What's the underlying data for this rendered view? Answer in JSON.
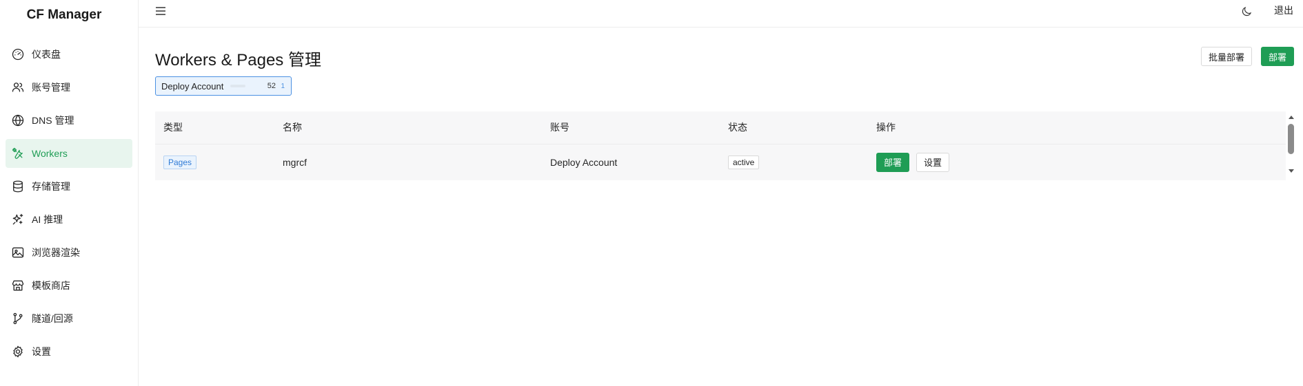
{
  "app": {
    "title": "CF Manager"
  },
  "sidebar": {
    "items": [
      {
        "label": "仪表盘",
        "icon": "dashboard-icon",
        "active": false
      },
      {
        "label": "账号管理",
        "icon": "users-icon",
        "active": false
      },
      {
        "label": "DNS 管理",
        "icon": "globe-icon",
        "active": false
      },
      {
        "label": "Workers",
        "icon": "tools-icon",
        "active": true
      },
      {
        "label": "存储管理",
        "icon": "database-icon",
        "active": false
      },
      {
        "label": "AI 推理",
        "icon": "sparkles-icon",
        "active": false
      },
      {
        "label": "浏览器渲染",
        "icon": "image-icon",
        "active": false
      },
      {
        "label": "模板商店",
        "icon": "store-icon",
        "active": false
      },
      {
        "label": "隧道/回源",
        "icon": "branch-icon",
        "active": false
      },
      {
        "label": "设置",
        "icon": "gear-icon",
        "active": false
      }
    ]
  },
  "topbar": {
    "logout_label": "退出",
    "menu_icon": "menu-icon",
    "theme_icon": "moon-icon"
  },
  "page": {
    "title": "Workers & Pages 管理",
    "batch_deploy_label": "批量部署",
    "deploy_label": "部署"
  },
  "account_chip": {
    "name": "Deploy Account",
    "count": "52",
    "sub": "1"
  },
  "table": {
    "headers": [
      "类型",
      "名称",
      "账号",
      "状态",
      "操作"
    ],
    "rows": [
      {
        "type": "Pages",
        "name": "mgrcf",
        "account": "Deploy Account",
        "status": "active",
        "deploy_label": "部署",
        "settings_label": "设置"
      }
    ]
  },
  "colors": {
    "accent": "#1f9d55",
    "active_bg": "#e8f5ee",
    "info_blue": "#4a90e2"
  }
}
